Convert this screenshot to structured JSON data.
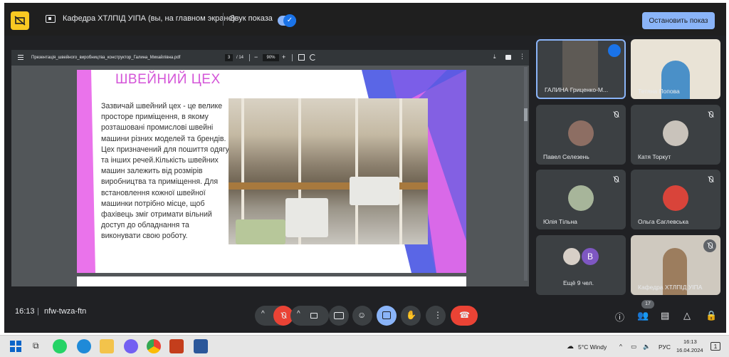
{
  "topbar": {
    "presenting_title": "Кафедра ХТЛПІД УІПА (вы, на главном экране)",
    "audio_label": "Звук показа",
    "stop_button": "Остановить показ"
  },
  "pdf": {
    "filename": "Презентація_швейного_виробництва_конструктор_Галина_Михайлівна.pdf",
    "current_page": "3",
    "page_count": "/ 14",
    "zoom": "90%",
    "zoom_minus": "−",
    "zoom_plus": "+"
  },
  "slide": {
    "title": "ШВЕЙНИЙ ЦЕХ",
    "body": "Зазвичай швейний цех - це велике просторе приміщення, в якому розташовані промислові швейні машини різних моделей та брендів. Цех призначений для пошиття одягу та інших речей.Кількість швейних машин залежить від розмірів виробництва та приміщення. Для встановлення кожної швейної машинки потрібно місце, щоб фахівець зміг отримати вільний доступ до обладнання та виконувати свою роботу."
  },
  "participants": [
    {
      "name": "ГАЛИНА Гриценко-М...",
      "status": "speaking"
    },
    {
      "name": "Тетяна Попова",
      "status": "muted"
    },
    {
      "name": "Павел Селезень",
      "status": "muted"
    },
    {
      "name": "Катя Торкут",
      "status": "muted"
    },
    {
      "name": "Юлія Тільна",
      "status": "muted"
    },
    {
      "name": "Ольга Єаглевська",
      "status": "muted"
    },
    {
      "name": "Ещё 9 чел.",
      "avatar_letter": "В"
    },
    {
      "name": "Кафедра ХТЛПІД УІПА",
      "status": "muted"
    }
  ],
  "controls": {
    "time": "16:13",
    "meeting_code": "nfw-twza-ftn",
    "participants_badge": "17"
  },
  "taskbar": {
    "weather": "5°C Windy",
    "language": "РУС",
    "clock_time": "16:13",
    "clock_date": "16.04.2024",
    "notification_count": "1"
  },
  "colors": {
    "meet_background": "#202124",
    "tile_background": "#3c4043",
    "accent_blue": "#8ab4f8",
    "end_call_red": "#ea4335",
    "slide_title_pink": "#d455d8"
  }
}
